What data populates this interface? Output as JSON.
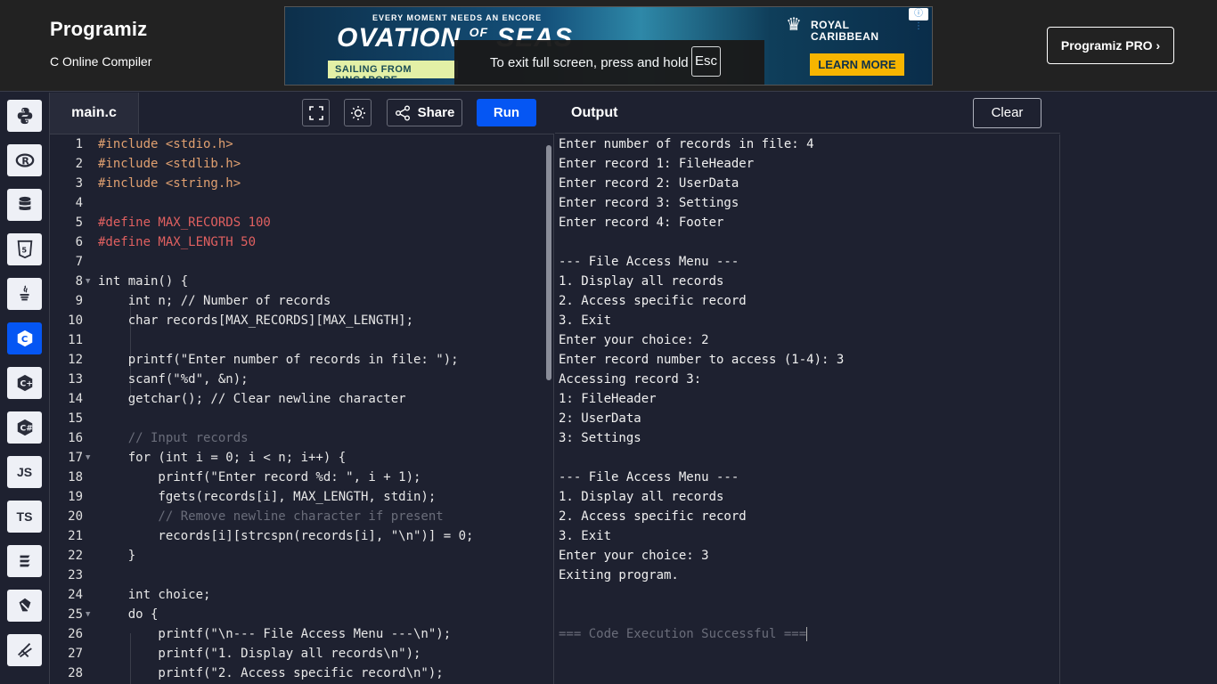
{
  "header": {
    "logo_text": "Programiz",
    "subtitle": "C Online Compiler",
    "pro_button": "Programiz PRO ›"
  },
  "ad": {
    "tagline": "EVERY MOMENT NEEDS AN ENCORE",
    "title_main": "OVATION",
    "title_of": "OF",
    "title_end": "SEAS",
    "sailing": "SAILING FROM SINGAPORE",
    "brand_line1": "ROYAL",
    "brand_line2": "CARIBBEAN",
    "cta": "LEARN MORE",
    "info": "ⓘ ⋮"
  },
  "fullscreen_tip": {
    "text": "To exit full screen, press and hold",
    "key": "Esc"
  },
  "sidebar": {
    "languages": [
      {
        "name": "python-icon",
        "label": ""
      },
      {
        "name": "r-icon",
        "label": ""
      },
      {
        "name": "sql-icon",
        "label": ""
      },
      {
        "name": "html-icon",
        "label": ""
      },
      {
        "name": "java-icon",
        "label": ""
      },
      {
        "name": "c-icon",
        "label": "",
        "active": true
      },
      {
        "name": "cpp-icon",
        "label": ""
      },
      {
        "name": "csharp-icon",
        "label": ""
      },
      {
        "name": "js-icon",
        "label": "JS"
      },
      {
        "name": "ts-icon",
        "label": "TS"
      },
      {
        "name": "go-icon",
        "label": ""
      },
      {
        "name": "php-icon",
        "label": ""
      },
      {
        "name": "swift-icon",
        "label": ""
      }
    ]
  },
  "editor": {
    "file_name": "main.c",
    "share_label": "Share",
    "run_label": "Run"
  },
  "code_lines": [
    "1",
    "2",
    "3",
    "4",
    "5",
    "6",
    "7",
    "8",
    "9",
    "10",
    "11",
    "12",
    "13",
    "14",
    "15",
    "16",
    "17",
    "18",
    "19",
    "20",
    "21",
    "22",
    "23",
    "24",
    "25",
    "26",
    "27",
    "28"
  ],
  "code": {
    "l1": "#include <stdio.h>",
    "l2": "#include <stdlib.h>",
    "l3": "#include <string.h>",
    "l5": "#define MAX_RECORDS 100",
    "l6": "#define MAX_LENGTH 50",
    "l8": "int main() {",
    "l9": "    int n; // Number of records",
    "l10": "    char records[MAX_RECORDS][MAX_LENGTH];",
    "l12": "    printf(\"Enter number of records in file: \");",
    "l13": "    scanf(\"%d\", &n);",
    "l14": "    getchar(); // Clear newline character",
    "l16": "    // Input records",
    "l17": "    for (int i = 0; i < n; i++) {",
    "l18": "        printf(\"Enter record %d: \", i + 1);",
    "l19": "        fgets(records[i], MAX_LENGTH, stdin);",
    "l20": "        // Remove newline character if present",
    "l21": "        records[i][strcspn(records[i], \"\\n\")] = 0;",
    "l22": "    }",
    "l24": "    int choice;",
    "l25": "    do {",
    "l26": "        printf(\"\\n--- File Access Menu ---\\n\");",
    "l27": "        printf(\"1. Display all records\\n\");",
    "l28": "        printf(\"2. Access specific record\\n\");"
  },
  "output": {
    "title": "Output",
    "clear_label": "Clear",
    "lines": [
      "Enter number of records in file: 4",
      "Enter record 1: FileHeader",
      "Enter record 2: UserData",
      "Enter record 3: Settings",
      "Enter record 4: Footer",
      "",
      "--- File Access Menu ---",
      "1. Display all records",
      "2. Access specific record",
      "3. Exit",
      "Enter your choice: 2",
      "Enter record number to access (1-4): 3",
      "Accessing record 3:",
      "1: FileHeader",
      "2: UserData",
      "3: Settings",
      "",
      "--- File Access Menu ---",
      "1. Display all records",
      "2. Access specific record",
      "3. Exit",
      "Enter your choice: 3",
      "Exiting program."
    ],
    "success": "=== Code Execution Successful ==="
  }
}
